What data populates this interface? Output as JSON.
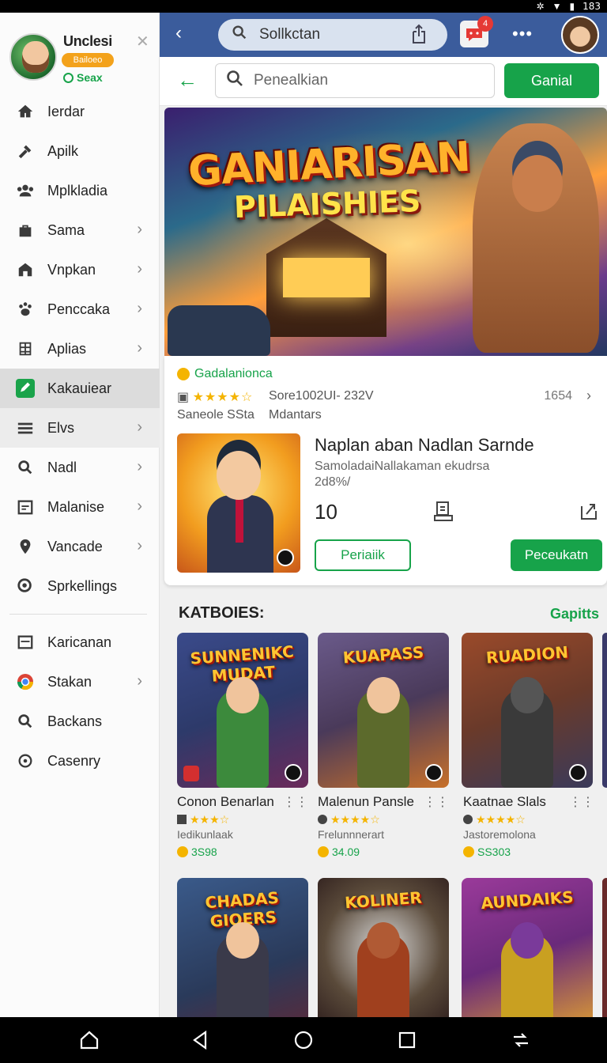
{
  "status_bar": {
    "time": "183"
  },
  "sidebar": {
    "profile": {
      "name": "Unclesi",
      "badge": "Bailoeo",
      "status": "Seax"
    },
    "items": [
      {
        "label": "Ierdar",
        "icon": "home-icon",
        "chevron": false
      },
      {
        "label": "Apilk",
        "icon": "hammer-icon",
        "chevron": false
      },
      {
        "label": "Mplkladia",
        "icon": "people-icon",
        "chevron": false
      },
      {
        "label": "Sama",
        "icon": "bag-icon",
        "chevron": true
      },
      {
        "label": "Vnpkan",
        "icon": "store-icon",
        "chevron": true
      },
      {
        "label": "Penccaka",
        "icon": "paw-icon",
        "chevron": true
      },
      {
        "label": "Aplias",
        "icon": "grid-icon",
        "chevron": true
      },
      {
        "label": "Kakauiear",
        "icon": "edit-icon",
        "chevron": false,
        "active": true
      },
      {
        "label": "Elvs",
        "icon": "menu-icon",
        "chevron": true
      },
      {
        "label": "Nadl",
        "icon": "search-icon",
        "chevron": true
      },
      {
        "label": "Malanise",
        "icon": "calendar-icon",
        "chevron": true
      },
      {
        "label": "Vancade",
        "icon": "location-icon",
        "chevron": true
      },
      {
        "label": "Sprkellings",
        "icon": "search-circle-icon",
        "chevron": false
      }
    ],
    "items2": [
      {
        "label": "Karicanan",
        "icon": "list-icon",
        "chevron": false
      },
      {
        "label": "Stakan",
        "icon": "chrome-icon",
        "chevron": true
      },
      {
        "label": "Backans",
        "icon": "search-icon",
        "chevron": false
      },
      {
        "label": "Casenry",
        "icon": "target-icon",
        "chevron": false
      }
    ]
  },
  "topbar": {
    "search_text": "Sollkctan",
    "notification_count": "4"
  },
  "searchrow": {
    "placeholder": "Penealkian",
    "button": "Ganial"
  },
  "hero": {
    "title": "GANIARISAN",
    "subtitle": "PILAISHIES"
  },
  "featured": {
    "developer": "Gadalanionca",
    "rating_stars": "★★★★☆",
    "score": "Sore1002UI- 232V",
    "count": "1654",
    "meta_left": "Saneole SSta",
    "meta_right": "Mdantars",
    "title": "Naplan aban Nadlan Sarnde",
    "description": "SamoladaiNallakaman ekudrsa 2d8%/",
    "rank": "10",
    "btn_secondary": "Periaiik",
    "btn_primary": "Peceukatn"
  },
  "categories": {
    "heading": "KATBOIES:",
    "link": "Gapitts",
    "tiles": [
      {
        "art_title": "SUNNENIKC MUDAT",
        "name": "Conon Benarlan",
        "stars": "★★★☆",
        "sub": "Iedikunlaak",
        "price": "3S98",
        "bg": "#2d3a6a",
        "accent": "#3c8a3c"
      },
      {
        "art_title": "KUAPASS",
        "name": "Malenun Pansle",
        "stars": "★★★★☆",
        "sub": "Frelunnnerart",
        "price": "34.09",
        "bg": "#4a3a5a",
        "accent": "#5c6a2c"
      },
      {
        "art_title": "RUADION",
        "name": "Kaatnae Slals",
        "stars": "★★★★☆",
        "sub": "Jastoremolona",
        "price": "SS303",
        "bg": "#6a3a2a",
        "accent": "#3a3a3a"
      },
      {
        "art_title": "CHADAS GIOERS",
        "bg": "#2a3a5a",
        "accent": "#3a3a4a"
      },
      {
        "art_title": "KOLINER",
        "bg": "#3a2a2a",
        "accent": "#a0401e"
      },
      {
        "art_title": "AUNDAIKS",
        "bg": "#6a2a7a",
        "accent": "#c9a021"
      }
    ]
  }
}
